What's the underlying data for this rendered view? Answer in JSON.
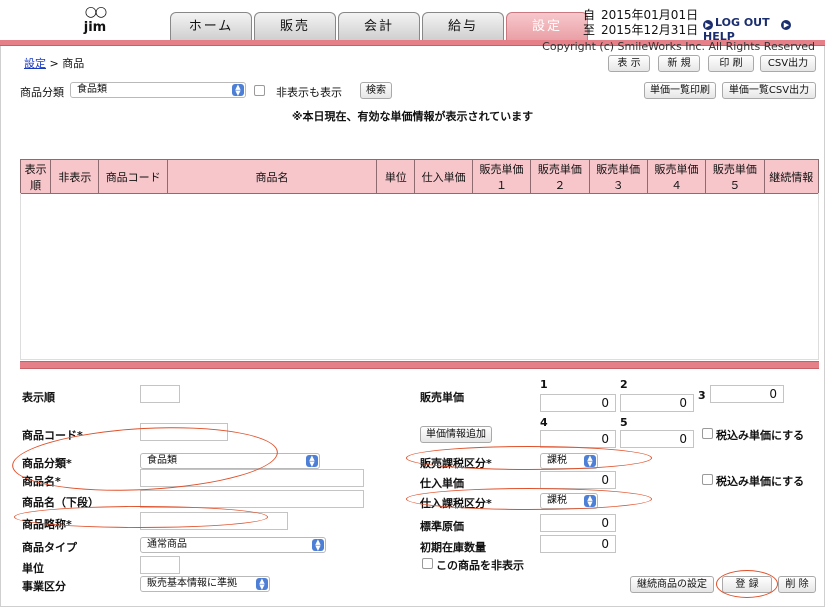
{
  "header": {
    "user_logo": "○○",
    "user_name": "jim",
    "tabs": [
      {
        "label": "ホーム",
        "active": false
      },
      {
        "label": "販売",
        "active": false
      },
      {
        "label": "会計",
        "active": false
      },
      {
        "label": "給与",
        "active": false
      },
      {
        "label": "設定",
        "active": true
      }
    ],
    "date_from_label": "自",
    "date_from": "2015年01月01日",
    "date_to_label": "至",
    "date_to": "2015年12月31日",
    "logout_label": "LOG OUT",
    "help_label": "HELP",
    "copyright": "Copyright (c) SmileWorks Inc. All Rights Reserved"
  },
  "breadcrumb": {
    "parent": "設定",
    "separator": ">",
    "current": "商品"
  },
  "toolbar": {
    "show": "表 示",
    "new": "新 規",
    "print": "印 刷",
    "csv": "CSV出力"
  },
  "filter": {
    "category_label": "商品分類",
    "category_value": "食品類",
    "show_hidden_label": "非表示も表示",
    "search": "検索",
    "price_list_print": "単価一覧印刷",
    "price_list_csv": "単価一覧CSV出力"
  },
  "notice": "※本日現在、有効な単価情報が表示されています",
  "table": {
    "columns": [
      "表示順",
      "非表示",
      "商品コード",
      "商品名",
      "単位",
      "仕入単価",
      "販売単価１",
      "販売単価２",
      "販売単価３",
      "販売単価４",
      "販売単価５",
      "継続情報"
    ]
  },
  "form": {
    "display_order": "表示順",
    "product_code": "商品コード*",
    "product_category": "商品分類*",
    "product_category_value": "食品類",
    "product_name": "商品名*",
    "product_name_lower": "商品名（下段）",
    "product_short": "商品略称*",
    "product_type": "商品タイプ",
    "product_type_value": "通常商品",
    "unit": "単位",
    "business_type": "事業区分",
    "business_type_value": "販売基本情報に準拠",
    "sales_price": "販売単価",
    "add_price_info": "単価情報追加",
    "sales_tax": "販売課税区分*",
    "sales_tax_value": "課税",
    "purchase_price": "仕入単価",
    "purchase_price_value": "0",
    "purchase_tax": "仕入課税区分*",
    "purchase_tax_value": "課税",
    "standard_cost": "標準原価",
    "standard_cost_value": "0",
    "initial_stock": "初期在庫数量",
    "initial_stock_value": "0",
    "hide_product": "この商品を非表示",
    "price_cols": [
      "1",
      "2",
      "3",
      "4",
      "5"
    ],
    "price_values": [
      "0",
      "0",
      "0",
      "0",
      "0"
    ],
    "tax_included": "税込み単価にする",
    "tax_included2": "税込み単価にする",
    "continuation": "継続商品の設定",
    "register": "登 録",
    "delete": "削 除"
  },
  "colors": {
    "accent": "#e68088",
    "header_pink": "#f6c6cb",
    "annotation": "#e0502a",
    "link": "#1a3bbf"
  }
}
